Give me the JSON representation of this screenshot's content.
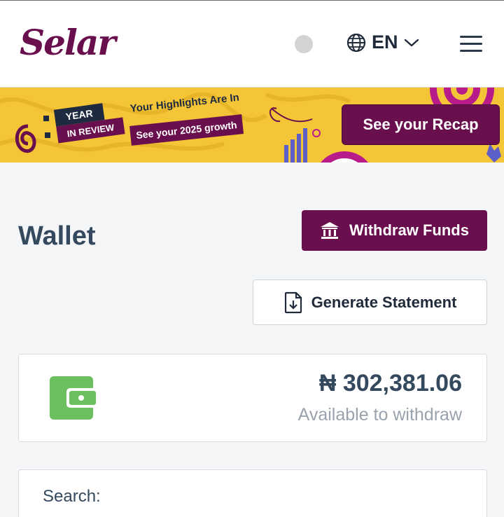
{
  "header": {
    "logo_text": "Selar",
    "language_code": "EN",
    "icons": [
      "globe-icon",
      "chevron-down-icon",
      "hamburger-menu-icon"
    ]
  },
  "banner": {
    "year_label": "YEAR",
    "review_label": "IN REVIEW",
    "highlights_text": "Your Highlights Are In",
    "growth_text": "See your 2025 growth",
    "recap_button": "See your Recap",
    "colors": {
      "background": "#f4c537",
      "brand": "#6a0f4e",
      "navy": "#1e2a3f"
    }
  },
  "page": {
    "title": "Wallet",
    "withdraw_button": "Withdraw Funds",
    "statement_button": "Generate Statement"
  },
  "balance": {
    "amount": "₦ 302,381.06",
    "caption": "Available to withdraw",
    "icon": "wallet-icon",
    "icon_color": "#6cbf5f"
  },
  "search": {
    "label": "Search:"
  }
}
